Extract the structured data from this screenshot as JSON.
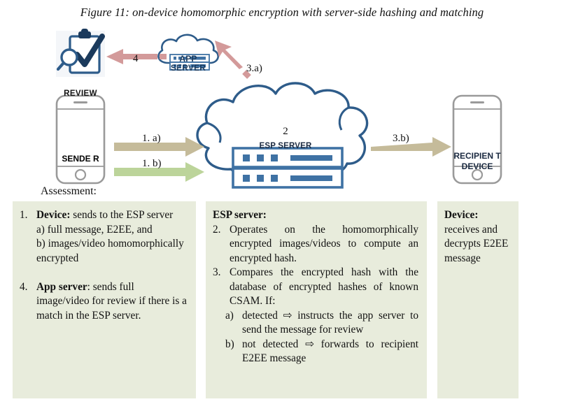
{
  "figure": {
    "title": "Figure 11: on-device homomorphic encryption with server-side hashing and matching"
  },
  "diagram": {
    "review_icon_label": "REVIEW",
    "app_server_label": "APP SERVER",
    "esp_server_number": "2",
    "esp_server_label": "ESP SERVER",
    "sender_label": "SENDE R",
    "recipient_label": "RECIPIEN T DEVICE",
    "arrows": [
      {
        "name": "sender-to-esp-full-message",
        "label": "1. a)",
        "color": "#c5bb9a"
      },
      {
        "name": "sender-to-esp-images",
        "label": "1. b)",
        "color": "#bcd49a"
      },
      {
        "name": "esp-to-app-server",
        "label": "3.a)",
        "color": "#d39a9a"
      },
      {
        "name": "app-server-to-review",
        "label": "4",
        "color": "#d39a9a"
      },
      {
        "name": "esp-to-recipient",
        "label": "3.b)",
        "color": "#c5bb9a"
      }
    ],
    "assessment_label": "Assessment:"
  },
  "boxes": {
    "left": {
      "items": [
        {
          "number": "1.",
          "lead": "Device:",
          "lead_bold": true,
          "text": " sends to the ESP server",
          "sublines": [
            "a) full message, E2EE, and",
            "b) images/video homomorphically encrypted"
          ]
        },
        {
          "number": "4.",
          "lead": "App server",
          "lead_bold": true,
          "text": ": sends full image/video for review if there is a match in the ESP server.",
          "sublines": []
        }
      ]
    },
    "middle": {
      "header": "ESP server:",
      "items": [
        {
          "number": "2.",
          "text": "Operates on the homomorphically encrypted images/videos to compute an encrypted hash.",
          "sublines": []
        },
        {
          "number": "3.",
          "text": "Compares the encrypted hash with the database of encrypted hashes of known CSAM. If:",
          "sublines": [
            {
              "mark": "a)",
              "text": "detected ⇨ instructs the app server to send the message for review"
            },
            {
              "mark": "b)",
              "text": "not detected ⇨ forwards to recipient E2EE message"
            }
          ]
        }
      ]
    },
    "right": {
      "header": "Device:",
      "text": "receives and decrypts E2EE message"
    }
  },
  "colors": {
    "box_bg": "#e8ecdc",
    "cloud_stroke": "#2e5c8a",
    "server_blue": "#3f72a4",
    "phone_gray": "#9a9a9a",
    "navy": "#1b3a5c",
    "tan_arrow": "#c5bb9a",
    "green_arrow": "#bcd49a",
    "pink_arrow": "#d39a9a"
  }
}
